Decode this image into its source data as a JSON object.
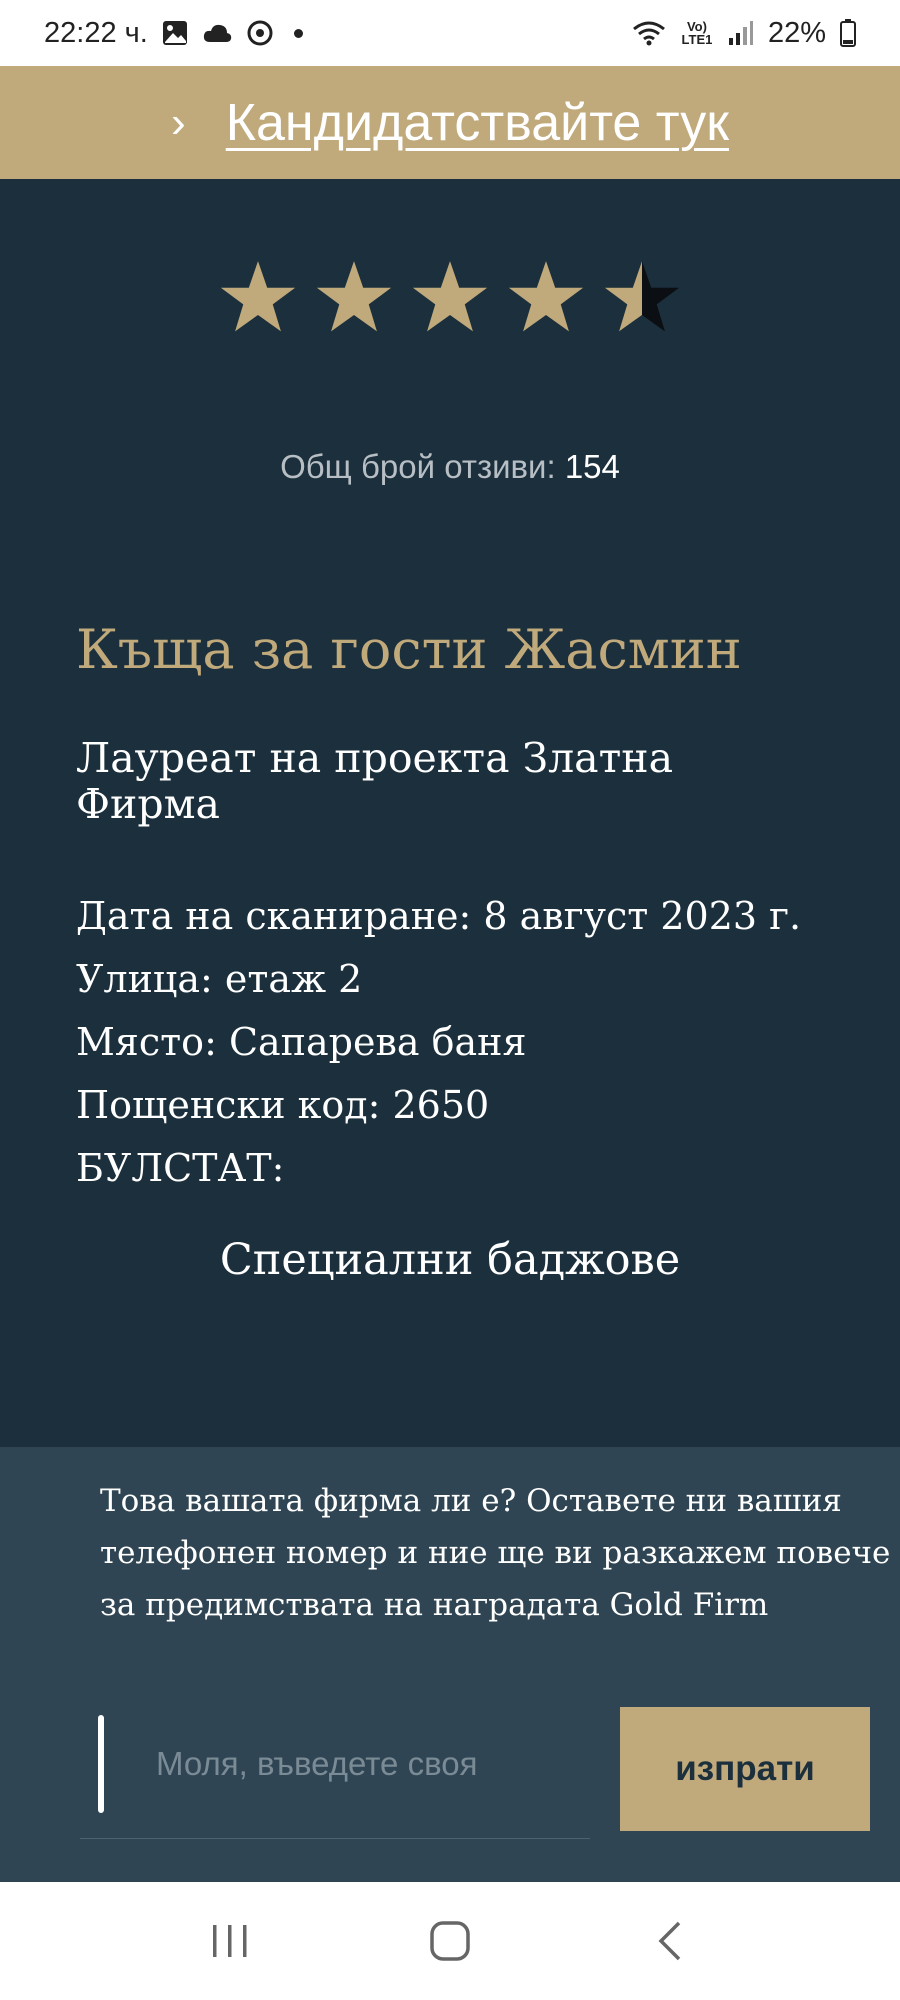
{
  "status_bar": {
    "time": "22:22 ч.",
    "battery": "22%",
    "network_label": "Vo) LTE1",
    "icons": [
      "gallery-icon",
      "cloud-icon",
      "sync-icon",
      "notification-dot",
      "wifi-icon",
      "lte-icon",
      "signal-icon",
      "battery-icon"
    ]
  },
  "banner": {
    "chevron": "›",
    "apply_label": "Кандидатствайте тук"
  },
  "rating": {
    "value": 4.5,
    "max": 5,
    "star_color": "#c0a97b"
  },
  "reviews": {
    "label": "Общ брой отзиви:",
    "count": "154"
  },
  "business": {
    "name": "Къща за гости Жасмин",
    "laureate": "Лауреат на проекта Златна Фирма",
    "details": [
      "Дата на сканиране: 8 август 2023 г.",
      "Улица: етаж 2",
      "Място: Сапарева баня",
      "Пощенски код: 2650",
      "БУЛСТАТ:"
    ],
    "badges_title": "Специални баджове"
  },
  "claim": {
    "text": "Това вашата фирма ли е? Оставете ни вашия телефонен номер и ние ще ви разкажем повече за предимствата на наградата Gold Firm",
    "phone_placeholder": "Моля, въведете своя",
    "phone_value": "",
    "send_label": "изпрати"
  },
  "colors": {
    "gold": "#c0a97b",
    "background": "#1b2f3c",
    "panel": "#2f4553"
  },
  "nav": {
    "buttons": [
      "recent-apps-icon",
      "home-icon",
      "back-icon"
    ]
  }
}
